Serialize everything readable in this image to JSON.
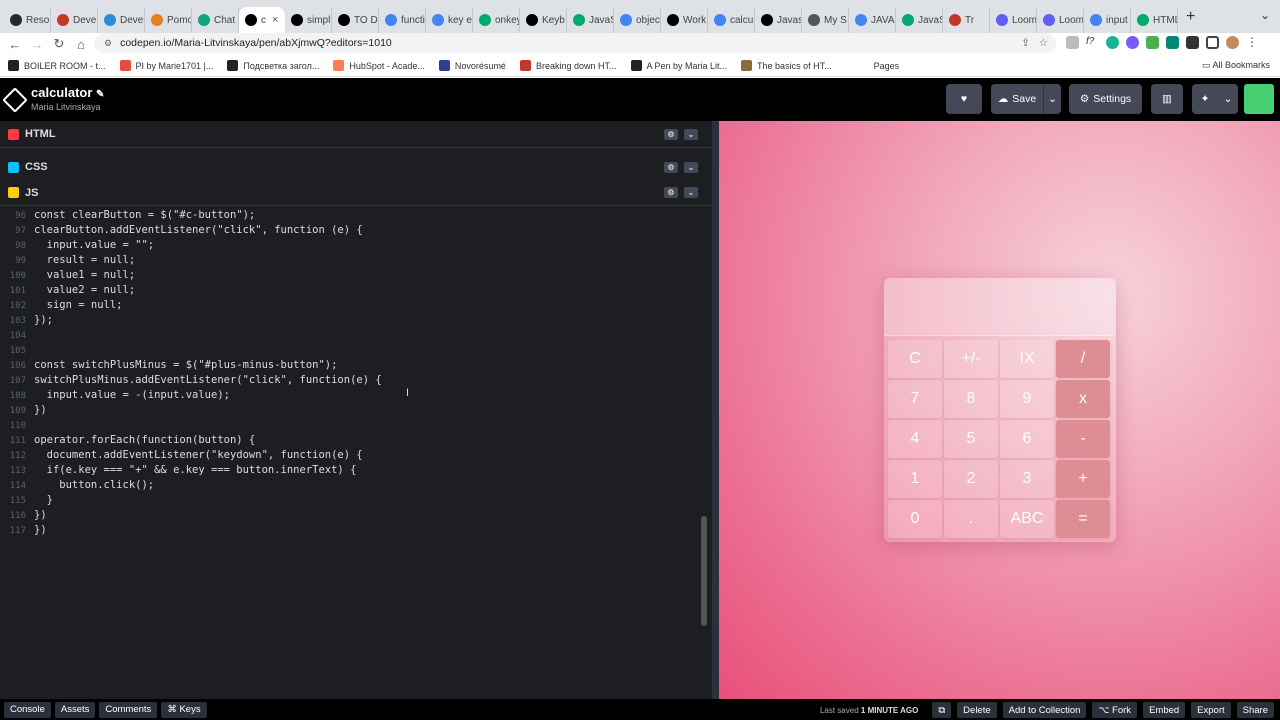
{
  "browser": {
    "tabs": [
      {
        "label": "Reso",
        "color": "#24292e"
      },
      {
        "label": "Deve",
        "color": "#c0392b"
      },
      {
        "label": "Deve",
        "color": "#2a8cd6"
      },
      {
        "label": "Pomo",
        "color": "#e67e22"
      },
      {
        "label": "Chat",
        "color": "#10a37f"
      },
      {
        "label": "c",
        "color": "#000000"
      },
      {
        "label": "simpl",
        "color": "#000000"
      },
      {
        "label": "TO D",
        "color": "#000000"
      },
      {
        "label": "functi",
        "color": "#4285f4"
      },
      {
        "label": "key e",
        "color": "#4285f4"
      },
      {
        "label": "onkey",
        "color": "#04aa6d"
      },
      {
        "label": "Keyb",
        "color": "#000000"
      },
      {
        "label": "JavaS",
        "color": "#04aa6d"
      },
      {
        "label": "objec",
        "color": "#4285f4"
      },
      {
        "label": "Work",
        "color": "#000000"
      },
      {
        "label": "calcu",
        "color": "#4285f4"
      },
      {
        "label": "Javas",
        "color": "#000000"
      },
      {
        "label": "My S",
        "color": "#555555"
      },
      {
        "label": "JAVA",
        "color": "#4285f4"
      },
      {
        "label": "JavaS",
        "color": "#04aa6d"
      },
      {
        "label": "Tr",
        "color": "#c0392b"
      },
      {
        "label": "Loom",
        "color": "#625df5"
      },
      {
        "label": "Loom",
        "color": "#625df5"
      },
      {
        "label": "input",
        "color": "#4285f4"
      },
      {
        "label": "HTML",
        "color": "#04aa6d"
      }
    ],
    "url": "codepen.io/Maria-Litvinskaya/pen/abXjmwQ?editors=1010",
    "bookmarks": [
      {
        "label": "BOILER ROOM - t...",
        "color": "#222222"
      },
      {
        "label": "PI by Marie1701 |...",
        "color": "#e74c3c"
      },
      {
        "label": "Подсветка загол...",
        "color": "#222222"
      },
      {
        "label": "HubSpot - Acade...",
        "color": "#ff7a59"
      },
      {
        "label": "Novorésumé",
        "color": "#2c3e90"
      },
      {
        "label": "Breaking down HT...",
        "color": "#c0392b"
      },
      {
        "label": "A Pen by Maria Lit...",
        "color": "#222222"
      },
      {
        "label": "The basics of HT...",
        "color": "#8b6b3e"
      },
      {
        "label": "Pages",
        "color": "#ffffff"
      }
    ],
    "all_bookmarks": "All Bookmarks"
  },
  "codepen": {
    "title": "calculator",
    "author": "Maria Litvinskaya",
    "save": "Save",
    "settings": "Settings",
    "panes": {
      "html": "HTML",
      "css": "CSS",
      "js": "JS"
    }
  },
  "code_lines": [
    {
      "n": "96",
      "t": "const clearButton = $(\"#c-button\");"
    },
    {
      "n": "97",
      "t": "clearButton.addEventListener(\"click\", function (e) {"
    },
    {
      "n": "98",
      "t": "  input.value = \"\";"
    },
    {
      "n": "99",
      "t": "  result = null;"
    },
    {
      "n": "100",
      "t": "  value1 = null;"
    },
    {
      "n": "101",
      "t": "  value2 = null;"
    },
    {
      "n": "102",
      "t": "  sign = null;"
    },
    {
      "n": "103",
      "t": "});"
    },
    {
      "n": "104",
      "t": ""
    },
    {
      "n": "105",
      "t": ""
    },
    {
      "n": "106",
      "t": "const switchPlusMinus = $(\"#plus-minus-button\");"
    },
    {
      "n": "107",
      "t": "switchPlusMinus.addEventListener(\"click\", function(e) {"
    },
    {
      "n": "108",
      "t": "  input.value = -(input.value);"
    },
    {
      "n": "109",
      "t": "})"
    },
    {
      "n": "110",
      "t": ""
    },
    {
      "n": "111",
      "t": "operator.forEach(function(button) {"
    },
    {
      "n": "112",
      "t": "  document.addEventListener(\"keydown\", function(e) {"
    },
    {
      "n": "113",
      "t": "  if(e.key === \"+\" && e.key === button.innerText) {"
    },
    {
      "n": "114",
      "t": "    button.click();"
    },
    {
      "n": "115",
      "t": "  }"
    },
    {
      "n": "116",
      "t": "})"
    },
    {
      "n": "117",
      "t": "})"
    }
  ],
  "calculator": {
    "display": "",
    "buttons": [
      {
        "label": "C",
        "op": false
      },
      {
        "label": "+/-",
        "op": false
      },
      {
        "label": "IX",
        "op": false
      },
      {
        "label": "/",
        "op": true
      },
      {
        "label": "7",
        "op": false
      },
      {
        "label": "8",
        "op": false
      },
      {
        "label": "9",
        "op": false
      },
      {
        "label": "x",
        "op": true
      },
      {
        "label": "4",
        "op": false
      },
      {
        "label": "5",
        "op": false
      },
      {
        "label": "6",
        "op": false
      },
      {
        "label": "-",
        "op": true
      },
      {
        "label": "1",
        "op": false
      },
      {
        "label": "2",
        "op": false
      },
      {
        "label": "3",
        "op": false
      },
      {
        "label": "+",
        "op": true
      },
      {
        "label": "0",
        "op": false
      },
      {
        "label": ".",
        "op": false
      },
      {
        "label": "ABC",
        "op": false
      },
      {
        "label": "=",
        "op": true
      }
    ]
  },
  "footer": {
    "console": "Console",
    "assets": "Assets",
    "comments": "Comments",
    "keys": "⌘ Keys",
    "last_saved_prefix": "Last saved",
    "last_saved_time": "1 MINUTE AGO",
    "delete": "Delete",
    "add_to_collection": "Add to Collection",
    "fork": "⌥ Fork",
    "embed": "Embed",
    "export": "Export",
    "share": "Share"
  }
}
